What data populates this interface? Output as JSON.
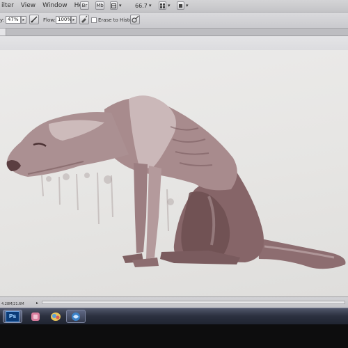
{
  "menubar": {
    "items": [
      "ilter",
      "View",
      "Window",
      "Help"
    ],
    "br_label": "Br",
    "mb_label": "Mb",
    "zoom": "66.7"
  },
  "options": {
    "opacity_label": "y:",
    "opacity_value": "47%",
    "flow_label": "Flow:",
    "flow_value": "100%",
    "erase_history_label": "Erase to History"
  },
  "statusbar": {
    "doc_info": "4.28M/21.6M"
  },
  "taskbar": {
    "ps_label": "Ps"
  },
  "colors": {
    "brush": "#7a5a5c",
    "canvas": "#e9e8e6",
    "ps_blue": "#0a3b78"
  },
  "icons": {
    "airbrush": "airbrush-icon",
    "tablet_pressure": "tablet-pressure-icon",
    "screen_mode": "screen-mode-icon",
    "arrange": "arrange-documents-icon"
  }
}
